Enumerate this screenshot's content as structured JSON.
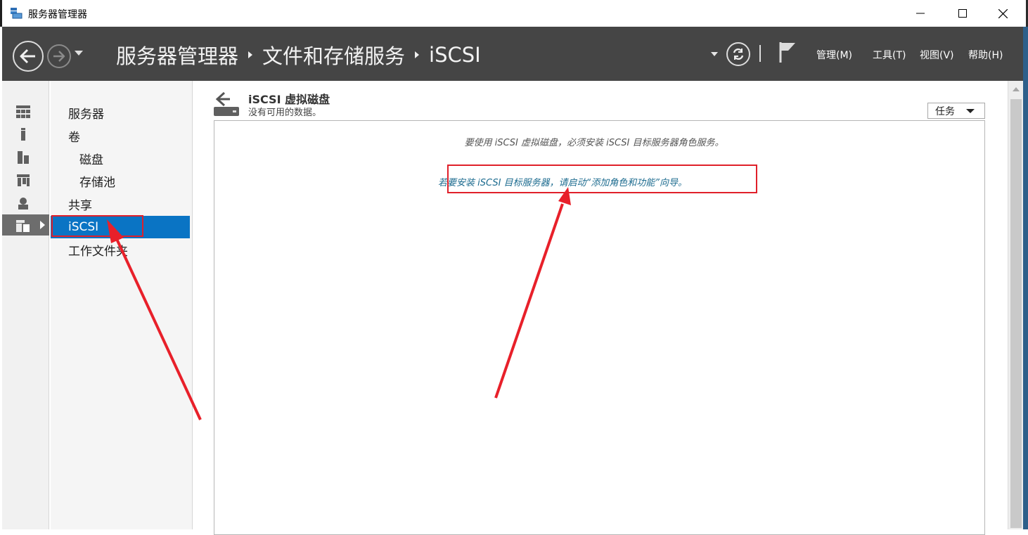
{
  "window": {
    "title": "服务器管理器",
    "minimize_label": "",
    "maximize_label": "",
    "close_label": ""
  },
  "header": {
    "breadcrumb": [
      "服务器管理器",
      "文件和存储服务",
      "iSCSI"
    ],
    "menus": [
      "管理(M)",
      "工具(T)",
      "视图(V)",
      "帮助(H)"
    ]
  },
  "rail": {
    "icons": [
      "dashboard-icon",
      "local-server-icon",
      "all-servers-icon",
      "server-group-icon",
      "roles-icon",
      "file-storage-icon"
    ],
    "active_index": 5
  },
  "nav": {
    "items": [
      {
        "label": "服务器",
        "level": 0
      },
      {
        "label": "卷",
        "level": 0
      },
      {
        "label": "磁盘",
        "level": 1
      },
      {
        "label": "存储池",
        "level": 1
      },
      {
        "label": "共享",
        "level": 0
      },
      {
        "label": "iSCSI",
        "level": 0,
        "selected": true
      },
      {
        "label": "工作文件夹",
        "level": 0
      }
    ]
  },
  "main": {
    "section_title": "iSCSI 虚拟磁盘",
    "section_subtitle": "没有可用的数据。",
    "tasks_label": "任务",
    "notice": "要使用 iSCSI 虚拟磁盘，必须安装 iSCSI 目标服务器角色服务。",
    "install_link": "若要安装 iSCSI 目标服务器，请启动“添加角色和功能”向导。"
  },
  "colors": {
    "header_bg": "#454545",
    "selected_bg": "#0a74c4",
    "link": "#1c6b8f",
    "annotation": "#e0202a"
  }
}
